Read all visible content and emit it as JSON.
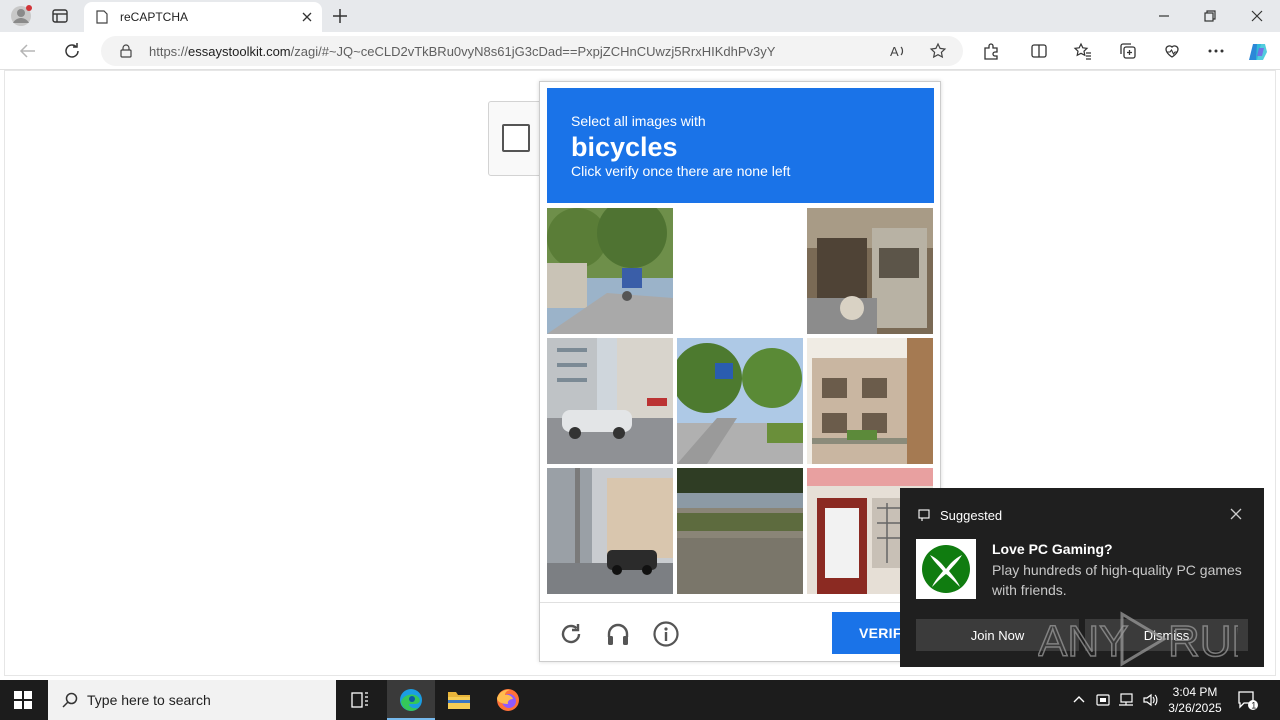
{
  "browser": {
    "tab_title": "reCAPTCHA",
    "url_prefix": "https://",
    "url_domain": "essaystoolkit.com",
    "url_rest": "/zagi/#~JQ~ceCLD2vTkBRu0vyN8s61jG3cDad==PxpjZCHnCUwzj5RrxHIKdhPv3yY"
  },
  "captcha": {
    "instruction": "Select all images with",
    "target": "bicycles",
    "subtext": "Click verify once there are none left",
    "verify_label": "VERIFY"
  },
  "notification": {
    "header": "Suggested",
    "title": "Love PC Gaming?",
    "body": "Play hundreds of high-quality PC games with friends.",
    "join_label": "Join Now",
    "dismiss_label": "Dismiss"
  },
  "taskbar": {
    "search_placeholder": "Type here to search",
    "time": "3:04 PM",
    "date": "3/26/2025",
    "notification_count": "1"
  },
  "watermark": {
    "text": "ANY RUN"
  },
  "colors": {
    "accent": "#1a73e8",
    "toast_bg": "#1f1f1f",
    "xbox_green": "#107c10"
  }
}
